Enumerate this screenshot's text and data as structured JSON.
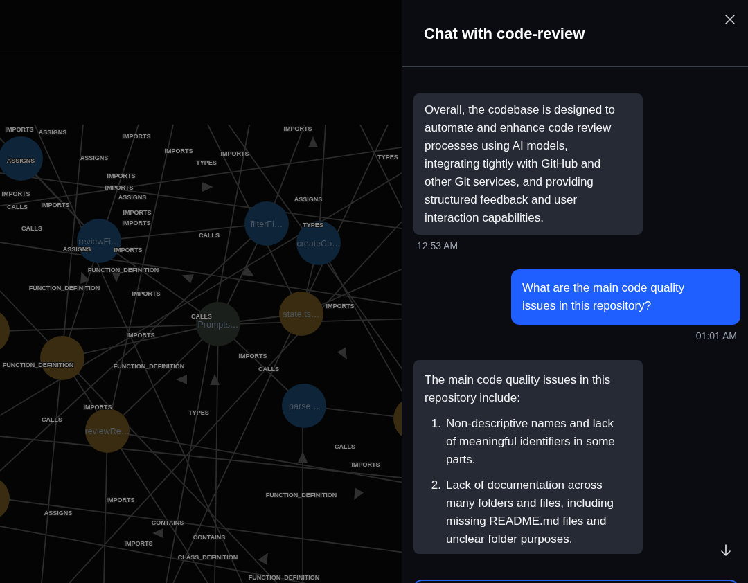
{
  "graph": {
    "nodes": [
      {
        "color": "#0e2438"
      },
      {
        "label": "reviewFi…",
        "color": "#0e2438"
      },
      {
        "label": "filterFi…",
        "color": "#0e2438"
      },
      {
        "label": "createCo…",
        "color": "#0e2438"
      },
      {
        "label": "Prompts…",
        "color": "#1b1f1c"
      },
      {
        "label": "state.ts…",
        "color": "#3a2c10"
      },
      {
        "color": "#3a2c10"
      },
      {
        "label": "reviewRe…",
        "color": "#3a2c10"
      },
      {
        "label": "parse…",
        "color": "#0e2438"
      },
      {
        "color": "#3a2c10"
      },
      {
        "color": "#3a2c10"
      },
      {
        "color": "#3a2c10"
      }
    ],
    "edge_labels": [
      "IMPORTS",
      "ASSIGNS",
      "IMPORTS",
      "IMPORTS",
      "TYPES",
      "IMPORTS",
      "IMPORTS",
      "TYPES",
      "ASSIGNS",
      "ASSIGNS",
      "IMPORTS",
      "IMPORTS",
      "ASSIGNS",
      "IMPORTS",
      "CALLS",
      "IMPORTS",
      "IMPORTS",
      "IMPORTS",
      "CALLS",
      "ASSIGNS",
      "IMPORTS",
      "ASSIGNS",
      "TYPES",
      "CALLS",
      "FUNCTION_DEFINITION",
      "FUNCTION_DEFINITION",
      "IMPORTS",
      "IMPORTS",
      "CALLS",
      "IMPORTS",
      "IMPORTS",
      "CALLS",
      "FUNCTION_DEFINITION",
      "FUNCTION_DEFINITION",
      "IMPORTS",
      "TYPES",
      "CALLS",
      "CALLS",
      "IMPORTS",
      "FUNCTION_DEFINITION",
      "IMPORTS",
      "ASSIGNS",
      "CONTAINS",
      "CONTAINS",
      "IMPORTS",
      "CLASS_DEFINITION",
      "FUNCTION_DEFINITION"
    ]
  },
  "chat": {
    "title": "Chat with code-review",
    "messages": [
      {
        "kind": "assistant",
        "text": "Overall, the codebase is designed to automate and enhance code review processes using AI models, integrating tightly with GitHub and other Git services, and providing structured feedback and user interaction capabilities.",
        "time": "12:53 AM"
      },
      {
        "kind": "user",
        "text": "What are the main code quality issues in this repository?",
        "time": "01:01 AM"
      },
      {
        "kind": "assistant",
        "text": "The main code quality issues in this repository include:",
        "items": [
          {
            "number": "1.",
            "text": "Non-descriptive names and lack of meaningful identifiers in some parts."
          },
          {
            "number": "2.",
            "text": "Lack of documentation across many folders and files, including missing README.md files and unclear folder purposes."
          }
        ]
      }
    ]
  }
}
